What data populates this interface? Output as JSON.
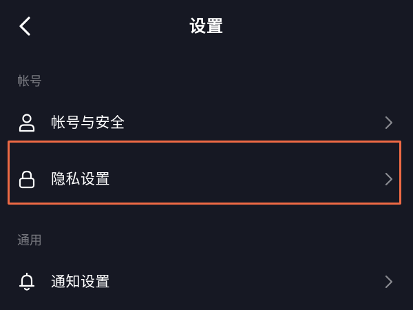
{
  "header": {
    "title": "设置",
    "back_icon": "chevron-left-icon"
  },
  "sections": [
    {
      "title": "帐号",
      "items": [
        {
          "label": "帐号与安全",
          "icon": "user-icon"
        },
        {
          "label": "隐私设置",
          "icon": "lock-icon",
          "highlighted": true
        }
      ]
    },
    {
      "title": "通用",
      "items": [
        {
          "label": "通知设置",
          "icon": "bell-icon"
        }
      ]
    }
  ],
  "colors": {
    "background": "#161823",
    "text": "#ffffff",
    "section_text": "#8a8b91",
    "highlight": "#ef6a45"
  }
}
